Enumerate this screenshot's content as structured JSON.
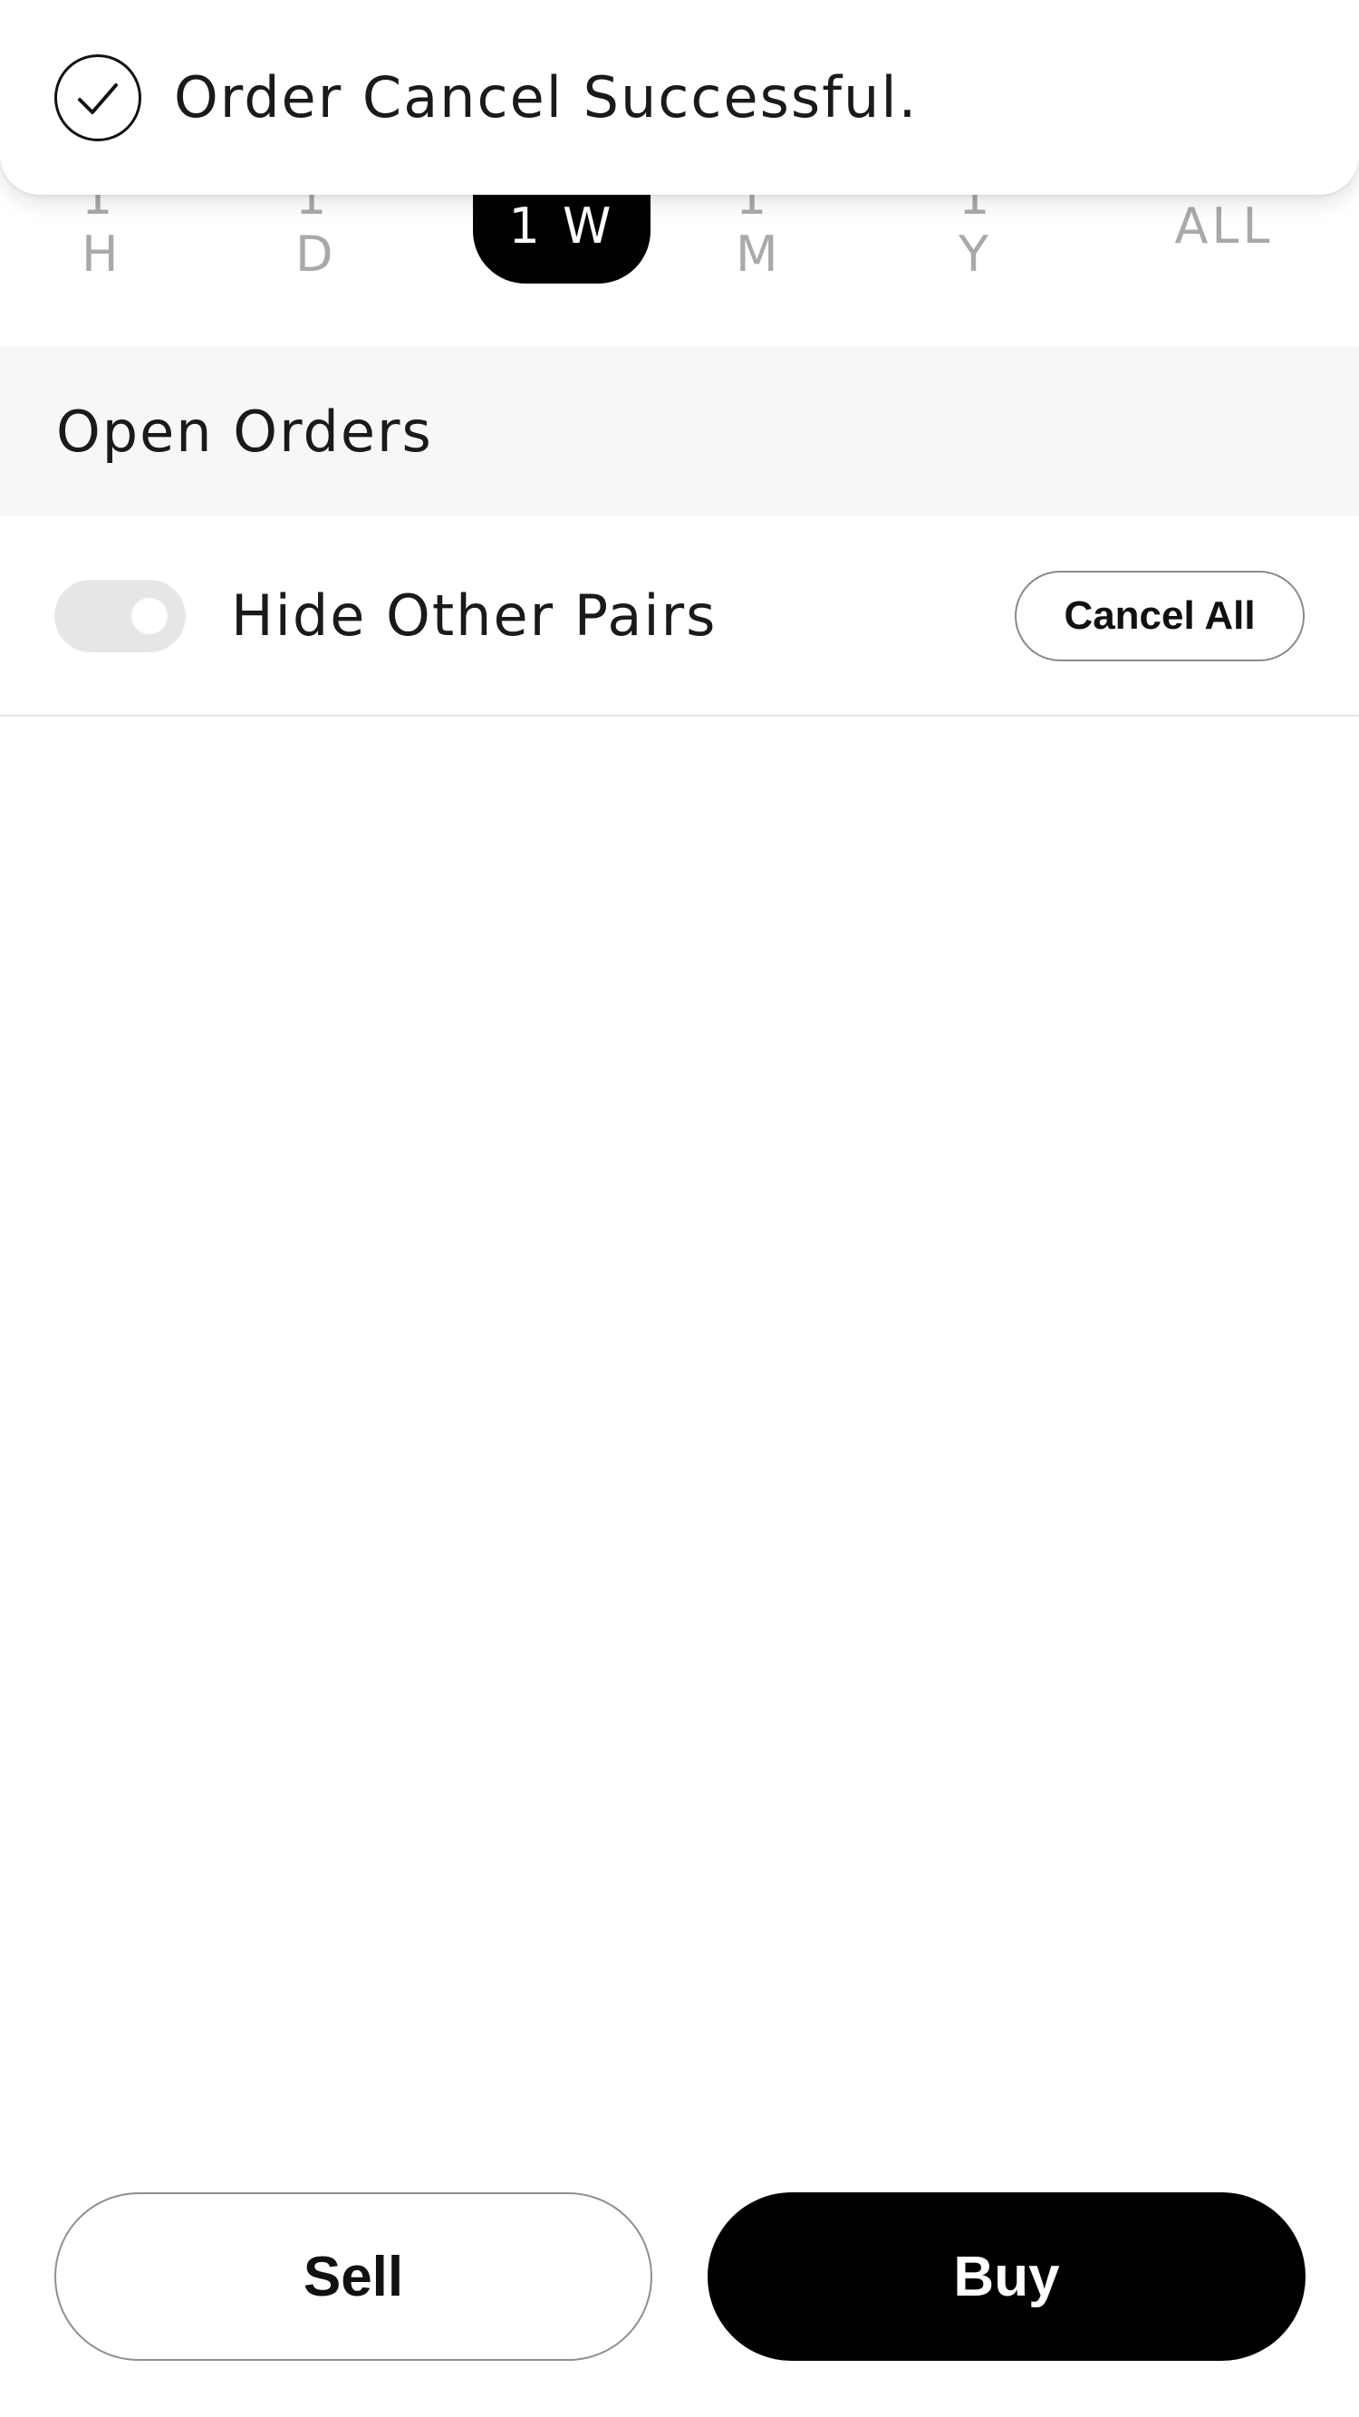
{
  "toast": {
    "icon": "check-circle-icon",
    "message": "Order Cancel Successful."
  },
  "time_range": {
    "tabs": [
      {
        "label": "1 H",
        "active": false
      },
      {
        "label": "1 D",
        "active": false
      },
      {
        "label": "1 W",
        "active": true
      },
      {
        "label": "1 M",
        "active": false
      },
      {
        "label": "1 Y",
        "active": false
      },
      {
        "label": "ALL",
        "active": false
      }
    ]
  },
  "open_orders": {
    "title": "Open Orders",
    "hide_other_pairs_label": "Hide Other Pairs",
    "hide_other_pairs_enabled": false,
    "cancel_all_label": "Cancel All"
  },
  "actions": {
    "sell_label": "Sell",
    "buy_label": "Buy"
  },
  "colors": {
    "accent": "#000000",
    "inactive_tab": "#a9a9a9",
    "section_bg": "#f7f7f7"
  }
}
